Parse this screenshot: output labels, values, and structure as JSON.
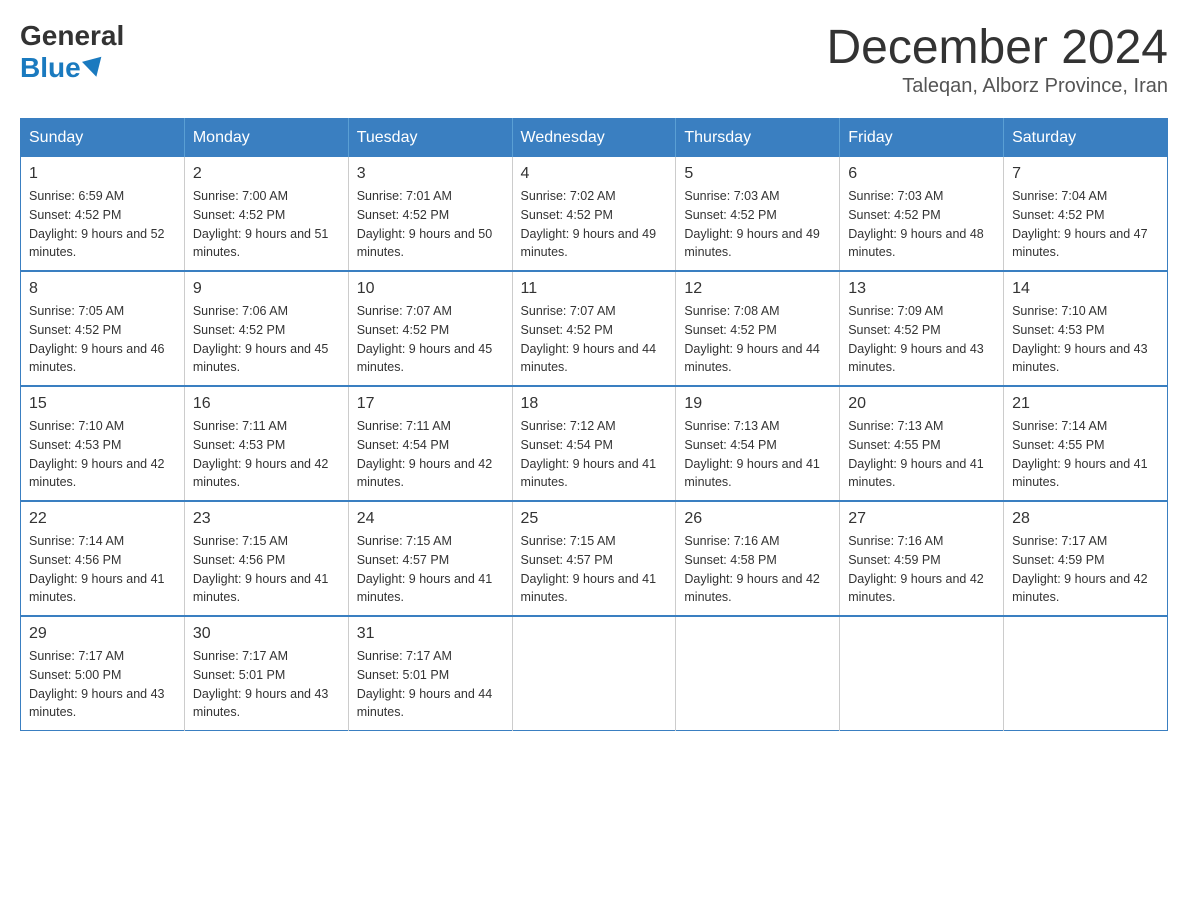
{
  "header": {
    "logo_general": "General",
    "logo_blue": "Blue",
    "month_title": "December 2024",
    "location": "Taleqan, Alborz Province, Iran"
  },
  "days_of_week": [
    "Sunday",
    "Monday",
    "Tuesday",
    "Wednesday",
    "Thursday",
    "Friday",
    "Saturday"
  ],
  "weeks": [
    [
      {
        "day": "1",
        "sunrise": "6:59 AM",
        "sunset": "4:52 PM",
        "daylight": "9 hours and 52 minutes."
      },
      {
        "day": "2",
        "sunrise": "7:00 AM",
        "sunset": "4:52 PM",
        "daylight": "9 hours and 51 minutes."
      },
      {
        "day": "3",
        "sunrise": "7:01 AM",
        "sunset": "4:52 PM",
        "daylight": "9 hours and 50 minutes."
      },
      {
        "day": "4",
        "sunrise": "7:02 AM",
        "sunset": "4:52 PM",
        "daylight": "9 hours and 49 minutes."
      },
      {
        "day": "5",
        "sunrise": "7:03 AM",
        "sunset": "4:52 PM",
        "daylight": "9 hours and 49 minutes."
      },
      {
        "day": "6",
        "sunrise": "7:03 AM",
        "sunset": "4:52 PM",
        "daylight": "9 hours and 48 minutes."
      },
      {
        "day": "7",
        "sunrise": "7:04 AM",
        "sunset": "4:52 PM",
        "daylight": "9 hours and 47 minutes."
      }
    ],
    [
      {
        "day": "8",
        "sunrise": "7:05 AM",
        "sunset": "4:52 PM",
        "daylight": "9 hours and 46 minutes."
      },
      {
        "day": "9",
        "sunrise": "7:06 AM",
        "sunset": "4:52 PM",
        "daylight": "9 hours and 45 minutes."
      },
      {
        "day": "10",
        "sunrise": "7:07 AM",
        "sunset": "4:52 PM",
        "daylight": "9 hours and 45 minutes."
      },
      {
        "day": "11",
        "sunrise": "7:07 AM",
        "sunset": "4:52 PM",
        "daylight": "9 hours and 44 minutes."
      },
      {
        "day": "12",
        "sunrise": "7:08 AM",
        "sunset": "4:52 PM",
        "daylight": "9 hours and 44 minutes."
      },
      {
        "day": "13",
        "sunrise": "7:09 AM",
        "sunset": "4:52 PM",
        "daylight": "9 hours and 43 minutes."
      },
      {
        "day": "14",
        "sunrise": "7:10 AM",
        "sunset": "4:53 PM",
        "daylight": "9 hours and 43 minutes."
      }
    ],
    [
      {
        "day": "15",
        "sunrise": "7:10 AM",
        "sunset": "4:53 PM",
        "daylight": "9 hours and 42 minutes."
      },
      {
        "day": "16",
        "sunrise": "7:11 AM",
        "sunset": "4:53 PM",
        "daylight": "9 hours and 42 minutes."
      },
      {
        "day": "17",
        "sunrise": "7:11 AM",
        "sunset": "4:54 PM",
        "daylight": "9 hours and 42 minutes."
      },
      {
        "day": "18",
        "sunrise": "7:12 AM",
        "sunset": "4:54 PM",
        "daylight": "9 hours and 41 minutes."
      },
      {
        "day": "19",
        "sunrise": "7:13 AM",
        "sunset": "4:54 PM",
        "daylight": "9 hours and 41 minutes."
      },
      {
        "day": "20",
        "sunrise": "7:13 AM",
        "sunset": "4:55 PM",
        "daylight": "9 hours and 41 minutes."
      },
      {
        "day": "21",
        "sunrise": "7:14 AM",
        "sunset": "4:55 PM",
        "daylight": "9 hours and 41 minutes."
      }
    ],
    [
      {
        "day": "22",
        "sunrise": "7:14 AM",
        "sunset": "4:56 PM",
        "daylight": "9 hours and 41 minutes."
      },
      {
        "day": "23",
        "sunrise": "7:15 AM",
        "sunset": "4:56 PM",
        "daylight": "9 hours and 41 minutes."
      },
      {
        "day": "24",
        "sunrise": "7:15 AM",
        "sunset": "4:57 PM",
        "daylight": "9 hours and 41 minutes."
      },
      {
        "day": "25",
        "sunrise": "7:15 AM",
        "sunset": "4:57 PM",
        "daylight": "9 hours and 41 minutes."
      },
      {
        "day": "26",
        "sunrise": "7:16 AM",
        "sunset": "4:58 PM",
        "daylight": "9 hours and 42 minutes."
      },
      {
        "day": "27",
        "sunrise": "7:16 AM",
        "sunset": "4:59 PM",
        "daylight": "9 hours and 42 minutes."
      },
      {
        "day": "28",
        "sunrise": "7:17 AM",
        "sunset": "4:59 PM",
        "daylight": "9 hours and 42 minutes."
      }
    ],
    [
      {
        "day": "29",
        "sunrise": "7:17 AM",
        "sunset": "5:00 PM",
        "daylight": "9 hours and 43 minutes."
      },
      {
        "day": "30",
        "sunrise": "7:17 AM",
        "sunset": "5:01 PM",
        "daylight": "9 hours and 43 minutes."
      },
      {
        "day": "31",
        "sunrise": "7:17 AM",
        "sunset": "5:01 PM",
        "daylight": "9 hours and 44 minutes."
      },
      null,
      null,
      null,
      null
    ]
  ],
  "labels": {
    "sunrise": "Sunrise: ",
    "sunset": "Sunset: ",
    "daylight": "Daylight: "
  }
}
